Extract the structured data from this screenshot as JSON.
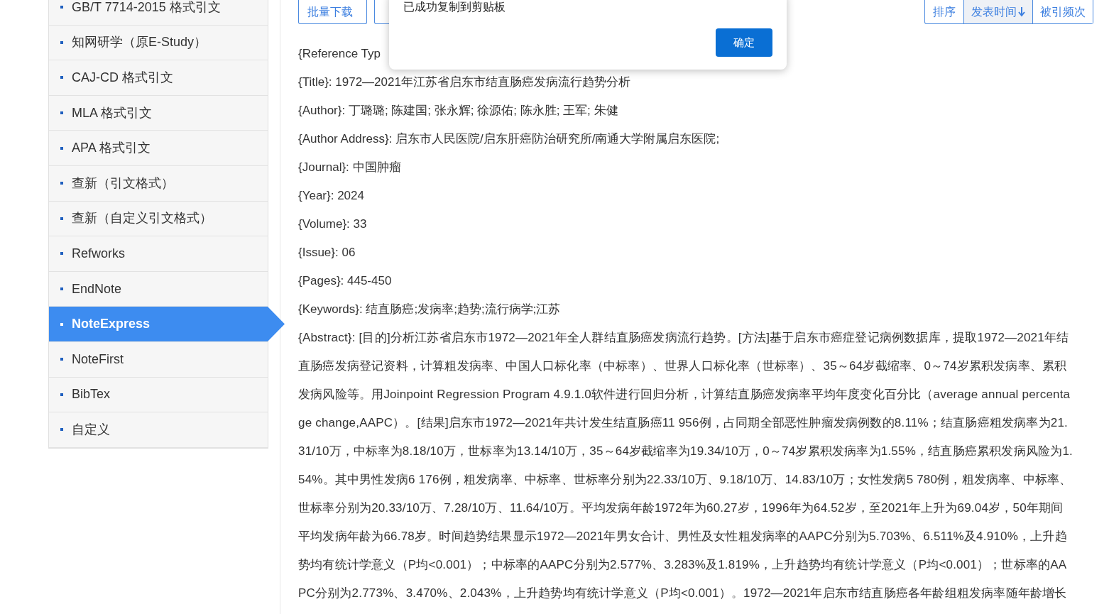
{
  "sidebar": {
    "items": [
      {
        "label": "GB/T 7714-2015 格式引文",
        "selected": false
      },
      {
        "label": "知网研学（原E-Study）",
        "selected": false
      },
      {
        "label": "CAJ-CD 格式引文",
        "selected": false
      },
      {
        "label": "MLA 格式引文",
        "selected": false
      },
      {
        "label": "APA 格式引文",
        "selected": false
      },
      {
        "label": "查新（引文格式）",
        "selected": false
      },
      {
        "label": "查新（自定义引文格式）",
        "selected": false
      },
      {
        "label": "Refworks",
        "selected": false
      },
      {
        "label": "EndNote",
        "selected": false
      },
      {
        "label": "NoteExpress",
        "selected": true
      },
      {
        "label": "NoteFirst",
        "selected": false
      },
      {
        "label": "BibTex",
        "selected": false
      },
      {
        "label": "自定义",
        "selected": false
      }
    ]
  },
  "toolbar": {
    "batch_download": "批量下载"
  },
  "sort": {
    "label": "排序",
    "options": [
      {
        "label": "发表时间",
        "selected": true
      },
      {
        "label": "被引频次",
        "selected": false
      }
    ]
  },
  "dialog": {
    "message": "已成功复制到剪贴板",
    "confirm": "确定"
  },
  "fields": [
    "{Reference Typ",
    "{Title}: 1972—2021年江苏省启东市结直肠癌发病流行趋势分析",
    "{Author}:  丁璐璐; 陈建国; 张永辉; 徐源佑; 陈永胜; 王军; 朱健",
    "{Author Address}: 启东市人民医院/启东肝癌防治研究所/南通大学附属启东医院;",
    "{Journal}: 中国肿瘤",
    "{Year}: 2024",
    "{Volume}: 33",
    "{Issue}: 06",
    "{Pages}: 445-450",
    "{Keywords}: 结直肠癌;发病率;趋势;流行病学;江苏"
  ],
  "abstract_lines": [
    "{Abstract}: [目的]分析江苏省启东市1972—2021年全人群结直肠癌发病流行趋势。[方法]基于启东市癌症登记病例数据库，提取1972—2021年结",
    "直肠癌发病登记资料，计算粗发病率、中国人口标化率（中标率）、世界人口标化率（世标率）、35～64岁截缩率、0～74岁累积发病率、累积",
    "发病风险等。用Joinpoint Regression Program 4.9.1.0软件进行回归分析，计算结直肠癌发病率平均年度变化百分比（average annual percenta",
    "ge change,AAPC）。[结果]启东市1972—2021年共计发生结直肠癌11 956例，占同期全部恶性肿瘤发病例数的8.11%；结直肠癌粗发病率为21.",
    "31/10万，中标率为8.18/10万，世标率为13.14/10万，35～64岁截缩率为19.34/10万，0～74岁累积发病率为1.55%，结直肠癌累积发病风险为1.",
    "54%。其中男性发病6 176例，粗发病率、中标率、世标率分别为22.33/10万、9.18/10万、14.83/10万；女性发病5 780例，粗发病率、中标率、",
    "世标率分别为20.33/10万、7.28/10万、11.64/10万。平均发病年龄1972年为60.27岁，1996年为64.52岁，至2021年上升为69.04岁，50年期间",
    "平均发病年龄为66.78岁。时间趋势结果显示1972—2021年男女合计、男性及女性粗发病率的AAPC分别为5.703%、6.511%及4.910%，上升趋",
    "势均有统计学意义（P均<0.001）；中标率的AAPC分别为2.577%、3.283%及1.819%，上升趋势均有统计学意义（P均<0.001）；世标率的AA",
    "PC分别为2.773%、3.470%、2.043%，上升趋势均有统计学意义（P均<0.001）。1972—2021年启东市结直肠癌各年龄组粗发病率随年龄增长"
  ]
}
